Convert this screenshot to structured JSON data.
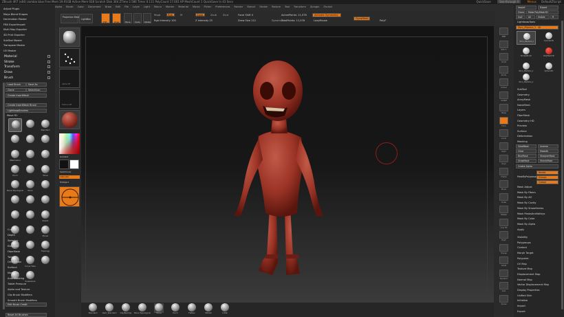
{
  "titlebar": {
    "left": "ZBrush 4R7 (x64)   zombie blue   Free Mem 19.91GB  Active Mem 928  Scratch Disk 364  ZTime 2.586  Timer 0.111  PolyCount 17.601 KP  MeshCount 1  QuickSave In 43 Secs",
    "quicksave": "QuickSave",
    "seethrough": "See-through 0",
    "menus": "Menus",
    "defaultscript": "DefaultZScript"
  },
  "menubar": [
    "Alpha",
    "Brush",
    "Color",
    "Document",
    "Draw",
    "Edit",
    "File",
    "Layer",
    "Light",
    "Macro",
    "Marker",
    "Material",
    "Movie",
    "Picker",
    "Preferences",
    "Render",
    "Stencil",
    "Stroke",
    "Texture",
    "Tool",
    "Transform",
    "Zplugin",
    "Zscript"
  ],
  "left": {
    "plugins": [
      "Adjust Plugin",
      "Maya Blend Shapes",
      "Decimation Master",
      "FBX ExportImport",
      "Multi Map Exporter",
      "3D Print Exporter",
      "SubTool Master",
      "Transpose Master",
      "UV Master"
    ],
    "sections": [
      "Material",
      "Stroke",
      "Transform",
      "Draw",
      "Brush"
    ],
    "load_brush": "Load Brush",
    "save_as": "Save As",
    "clone": "Clone",
    "selecticon": "SelectIcon",
    "create_insertmesh": "Create InsertMesh",
    "create_insertmesh_brush": "Create InsertMesh Brush",
    "lightbox_brushes": "Lightbox▸Brushes",
    "brush_count": "Move R1",
    "brushes": [
      "",
      "",
      "Standard",
      "",
      "",
      "",
      "ZRemesher",
      "",
      "",
      "Pinch",
      "",
      "Move",
      "Move Topological",
      "Move",
      "",
      "",
      "",
      "",
      "",
      "",
      "Slash1",
      "",
      "",
      "Planar",
      "",
      "",
      "Topology",
      "",
      "Curve Tube",
      "",
      "",
      "Snakehook"
    ],
    "settings": [
      "Curves",
      "Depth",
      "Samples",
      "Elasticity",
      "FiberMesh",
      "Twist",
      "Orientation",
      "Surface",
      "Modifiers",
      "Auto Masking",
      "Tablet Pressure",
      "Alpha and Texture",
      "Clip Brush Modifiers",
      "Smooth Brush Modifiers"
    ],
    "edit_brush_credit": "Edit Brush Credit",
    "reset_all": "Reset All Brushes"
  },
  "topbar": {
    "projection_master": "Projection Master",
    "lightbox": "LightBox",
    "draw": "Draw",
    "move": "Move",
    "scale": "Scale",
    "rotate": "Rotate",
    "mrgb": "Mrgb",
    "rgb": "Rgb",
    "m": "M",
    "rgb_intensity": "Rgb Intensity 100",
    "zadd": "Zadd",
    "zsub": "Zsub",
    "zcut": "Zcut",
    "z_intensity": "Z Intensity 25",
    "focal_shift": "Focal Shift 0",
    "draw_size": "Draw Size 112",
    "dynamic": "Dynamic",
    "active_points": "ActivePoints: 11,076",
    "total_points": "TotalPoints: 11,076",
    "activate_symmetry": "Activate Symmetry",
    "lazymouse": "LazyMouse",
    "dynamesh": "DynaMesh",
    "polyf": "PolyF",
    "r": "R",
    "x": ">X<",
    "y": ">Y<",
    "z": ">Z<",
    "m_sym": ">M<",
    "lsym": "L.Sym",
    "edit": "Edit",
    "gizmo": "Gizmo 3D",
    "subtool": "SubTool"
  },
  "left_shelf": {
    "gradient": "Gradient",
    "switchcolor": "SwitchColor",
    "alternate": "Alternate",
    "fillobject": "FillObject",
    "texture_off": "Texture Off",
    "material": "Material",
    "alpha_off": "Alpha Off"
  },
  "right_dock": [
    "BPR",
    "SPix 3",
    "Scroll",
    "Zoom",
    "Actual",
    "AAHalf",
    "Persp",
    "Floor",
    "Local",
    "LSym",
    "Gxyz",
    "Frame",
    "Move",
    "Scale",
    "Rotate",
    "Line Fill",
    "PolyF",
    "Transp",
    "Ghost",
    "Dynamic",
    "Solo",
    "Xpose"
  ],
  "right": {
    "import": "Import",
    "export": "Export",
    "clone": "Clone",
    "make_polymesh3d": "Make PolyMesh3D",
    "goz": "GoZ",
    "all": "All",
    "visible": "Visible",
    "r": "R",
    "lightbox_tools": "Lightbox▸Tools",
    "tool_name": "Zbro_ZSphere_1 . 48",
    "tools": [
      "Zbro_ZSphere_1",
      "Cylinder3D",
      "SimpleBrush",
      "PolyMesh3D",
      "Zbro_ZSphere_1",
      "Sphere3D",
      "Zbro_ZSphere_1"
    ],
    "sections": [
      "SubTool",
      "Geometry",
      "ArrayMesh",
      "NanoMesh",
      "Layers",
      "FiberMesh",
      "Geometry HD",
      "Preview",
      "Surface",
      "Deformation",
      "Masking"
    ],
    "viewmask": "ViewMask",
    "inverse": "Inverse",
    "clear": "Clear",
    "maskall": "MaskAll",
    "blurmask": "BlurMask",
    "sharpenmask": "SharpenMask",
    "growmask": "GrowMask",
    "shrinkmask": "ShrinkMask",
    "createalpha": "Create Alpha",
    "maskbypolygroups": "MaskByPolygroups",
    "border": "Border",
    "groups": "Groups",
    "crease": "Crease",
    "mask_list": [
      "Mask Adjust",
      "Mask By Fibers",
      "Mask By AO",
      "Mask By Cavity",
      "Mask By Smoothness",
      "Mask PeaksAndValleys",
      "Mask By Color",
      "Mask By Alpha",
      "Apply"
    ],
    "more": [
      "Visibility",
      "Polygroups",
      "Contact",
      "Morph Target",
      "Polypaint",
      "UV Map",
      "Texture Map",
      "Displacement Map",
      "Normal Map",
      "Vector Displacement Map",
      "Display Properties",
      "Unified Skin",
      "Initialize",
      "Import",
      "Export"
    ]
  },
  "bottom_brushes": [
    "Standard",
    "Dam_Standard",
    "ClayBuildup",
    "Move Topological",
    "Move",
    "Pinch",
    "Flatten",
    "hPolish",
    "Inflat"
  ],
  "colors": {
    "accent": "#e87a1a",
    "model": "#a13b2e",
    "cursor": "#8a1e1e"
  }
}
